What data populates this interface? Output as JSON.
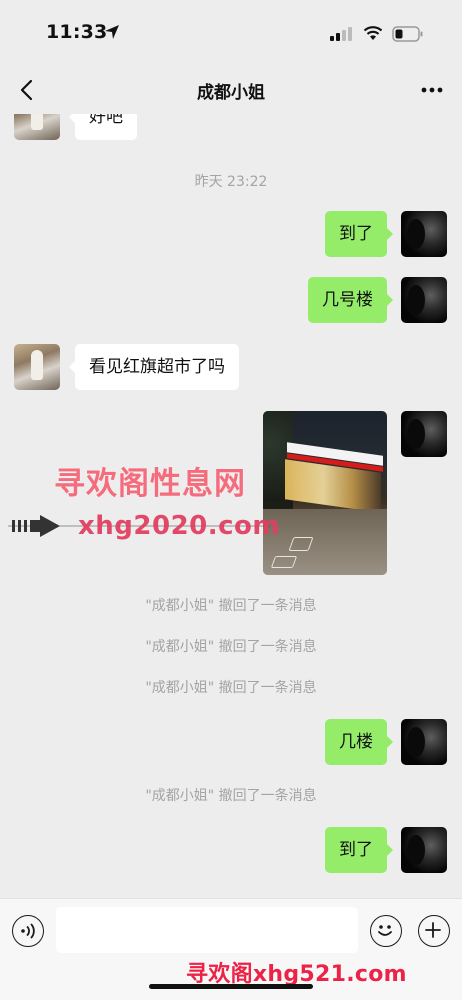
{
  "status_bar": {
    "time": "11:33"
  },
  "header": {
    "title": "成都小姐",
    "back_icon": "chevron-left-icon",
    "more_icon": "ellipsis-icon"
  },
  "chat": {
    "partial_message": "好吧",
    "time_separator": "昨天 23:22",
    "messages": [
      {
        "from": "me",
        "text": "到了"
      },
      {
        "from": "me",
        "text": "几号楼"
      },
      {
        "from": "them",
        "text": "看见红旗超市了吗"
      },
      {
        "from": "me",
        "type": "image"
      },
      {
        "from": "me",
        "text": "几楼"
      },
      {
        "from": "me",
        "text": "到了"
      }
    ],
    "recall_notice": "\"成都小姐\" 撤回了一条消息"
  },
  "watermark": {
    "line1": "寻欢阁性息网",
    "line2": "xhg2020.com",
    "bottom": "寻欢阁xhg521.com"
  },
  "input_bar": {
    "voice_icon": "voice-icon",
    "emoji_icon": "emoji-icon",
    "plus_icon": "plus-icon"
  },
  "colors": {
    "background": "#ededed",
    "outgoing_bubble": "#95ec69",
    "incoming_bubble": "#ffffff",
    "system_text": "#a4a4a4"
  }
}
